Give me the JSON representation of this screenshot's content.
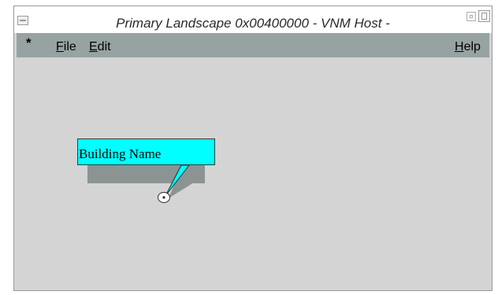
{
  "window": {
    "title": "Primary Landscape 0x00400000 - VNM Host -"
  },
  "menubar": {
    "star": "*",
    "file": {
      "mnemonic": "F",
      "rest": "ile"
    },
    "edit": {
      "mnemonic": "E",
      "rest": "dit"
    },
    "help": {
      "mnemonic": "H",
      "rest": "elp"
    }
  },
  "callout": {
    "label": "Building Name",
    "fill_color": "#00ffff",
    "shadow_color": "#8c9493"
  },
  "colors": {
    "menubar": "#97a3a2",
    "workspace": "#d4d4d4"
  },
  "icons": {
    "window_menu": "window-menu-icon",
    "minimize": "minimize-icon",
    "maximize": "maximize-icon",
    "anchor": "location-anchor-icon"
  }
}
